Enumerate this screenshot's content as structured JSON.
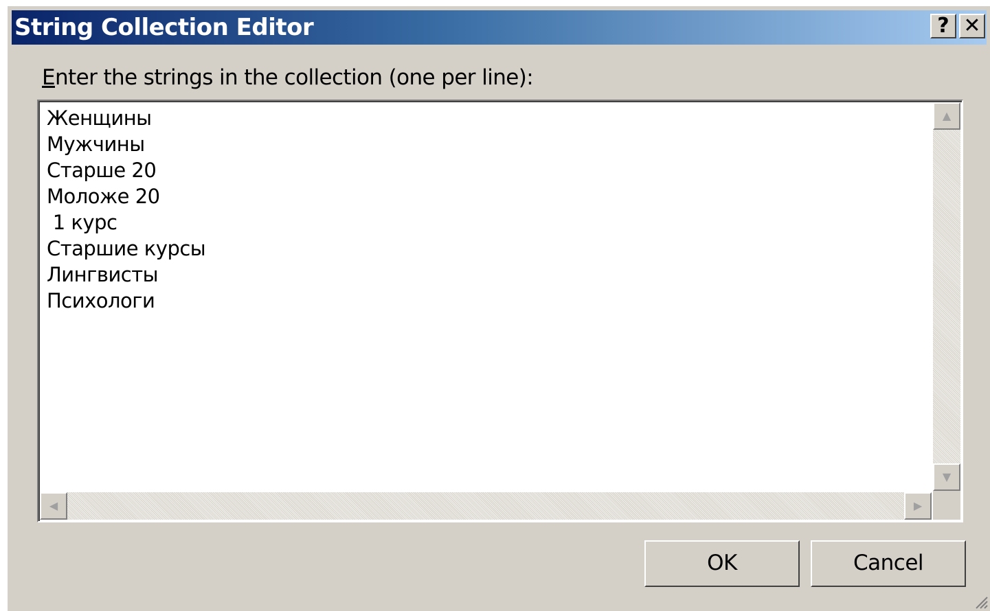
{
  "window": {
    "title": "String Collection Editor",
    "help_label": "?",
    "close_label": "✕"
  },
  "prompt": {
    "accel": "E",
    "rest": "nter the strings in the collection (one per line):"
  },
  "editor": {
    "lines": [
      "Женщины",
      "Мужчины",
      "Старше 20",
      "Моложе 20",
      " 1 курс",
      "Старшие курсы",
      "Лингвисты",
      "Психологи"
    ]
  },
  "scroll_icons": {
    "up": "▲",
    "down": "▼",
    "left": "◀",
    "right": "▶"
  },
  "buttons": {
    "ok": "OK",
    "cancel": "Cancel"
  },
  "colors": {
    "title_gradient_start": "#0a246a",
    "title_gradient_end": "#a6caf0",
    "dialog_face": "#d4d0c8"
  }
}
